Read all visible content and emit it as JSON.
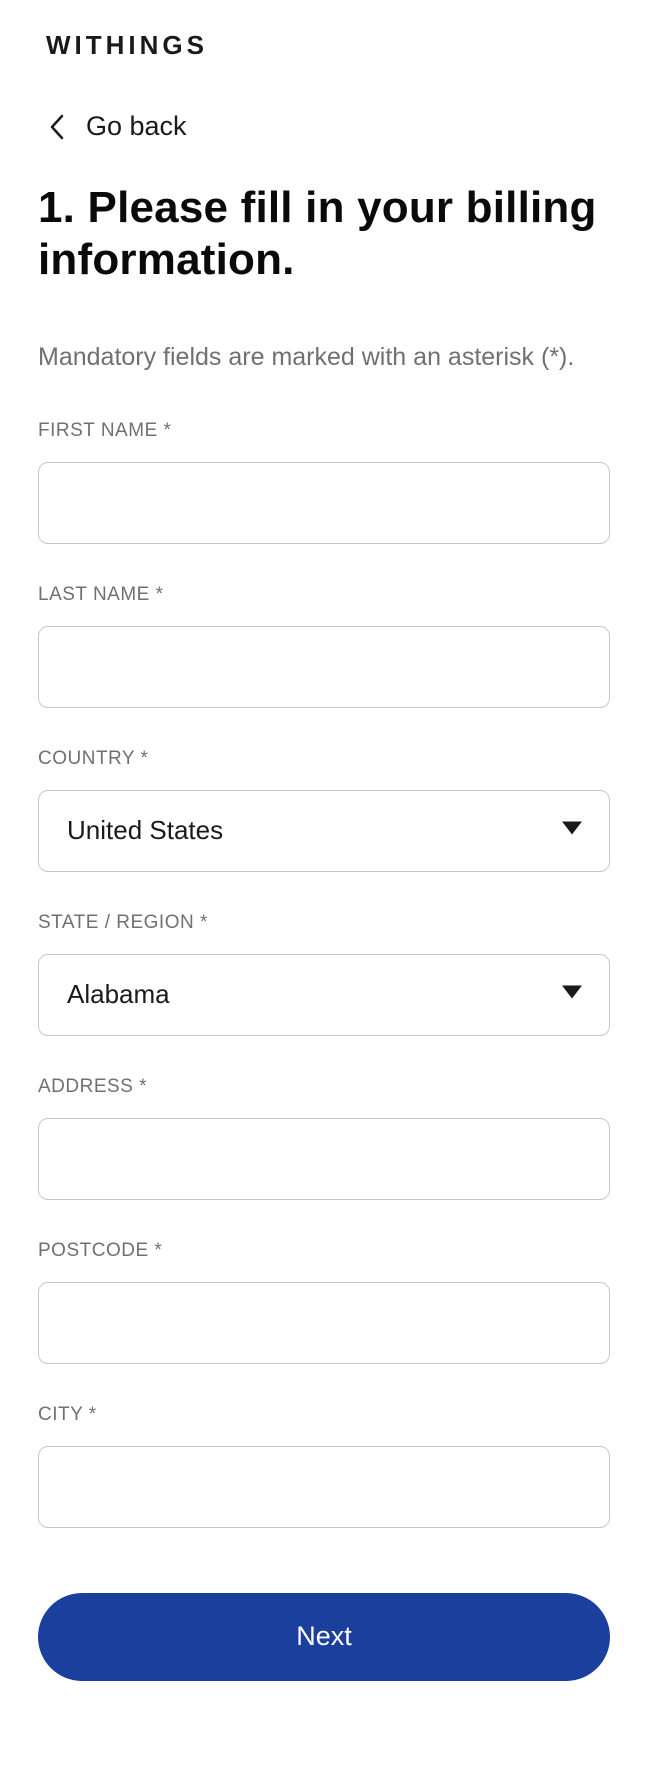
{
  "brand": "WITHINGS",
  "back_label": "Go back",
  "heading": "1. Please fill in your billing information.",
  "subtext": "Mandatory fields are marked with an asterisk (*).",
  "fields": {
    "first_name": {
      "label": "FIRST NAME *",
      "value": ""
    },
    "last_name": {
      "label": "LAST NAME *",
      "value": ""
    },
    "country": {
      "label": "COUNTRY *",
      "value": "United States"
    },
    "state": {
      "label": "STATE / REGION *",
      "value": "Alabama"
    },
    "address": {
      "label": "ADDRESS *",
      "value": ""
    },
    "postcode": {
      "label": "POSTCODE *",
      "value": ""
    },
    "city": {
      "label": "CITY *",
      "value": ""
    }
  },
  "next_label": "Next"
}
